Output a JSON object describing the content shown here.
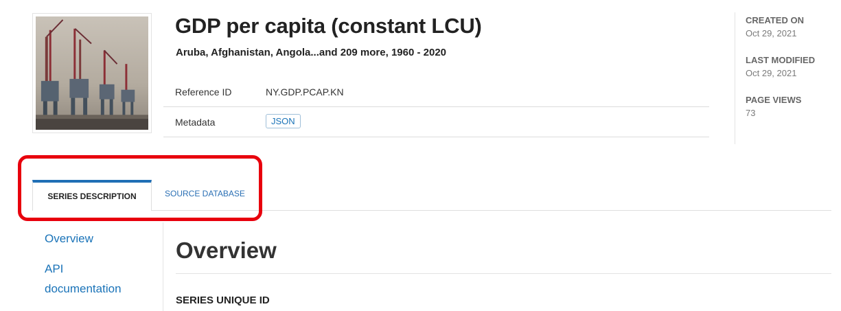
{
  "header": {
    "title": "GDP per capita (constant LCU)",
    "subtitle": "Aruba, Afghanistan, Angola...and 209 more, 1960 - 2020",
    "reference_label": "Reference ID",
    "reference_value": "NY.GDP.PCAP.KN",
    "metadata_label": "Metadata",
    "metadata_button": "JSON"
  },
  "stats": {
    "created_label": "CREATED ON",
    "created_value": "Oct 29, 2021",
    "modified_label": "LAST MODIFIED",
    "modified_value": "Oct 29, 2021",
    "views_label": "PAGE VIEWS",
    "views_value": "73"
  },
  "tabs": [
    {
      "label": "SERIES DESCRIPTION",
      "active": true
    },
    {
      "label": "SOURCE DATABASE",
      "active": false
    }
  ],
  "sidebar": {
    "overview_link": "Overview",
    "api_link_line1": "API",
    "api_link_line2": "documentation"
  },
  "main": {
    "section_title": "Overview",
    "field_label": "SERIES UNIQUE ID"
  },
  "colors": {
    "accent": "#1f6fb5",
    "link": "#1a73b8",
    "highlight": "#e8000d"
  },
  "icons": {
    "thumbnail": "port-cranes-image"
  }
}
